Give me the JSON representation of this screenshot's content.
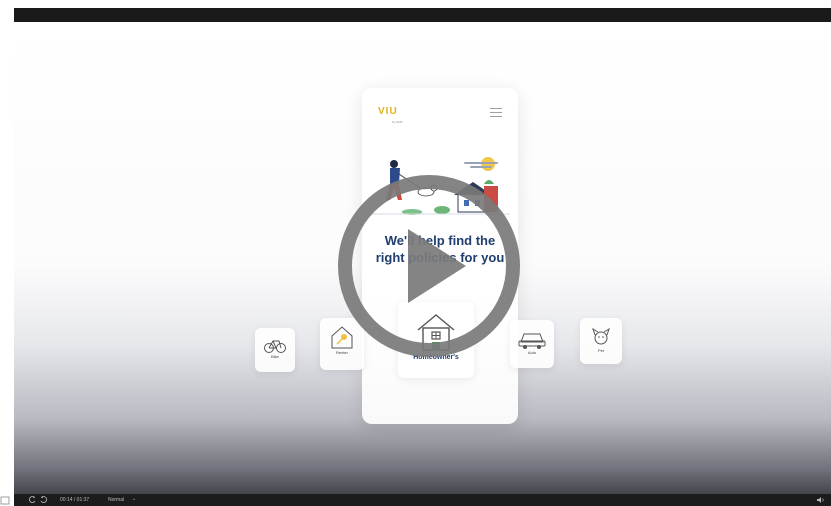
{
  "app": {
    "logo": "VIU",
    "logo_tagline": "by HUB",
    "headline_line1": "We'll help find the",
    "headline_line2": "right policies for you"
  },
  "categories": [
    {
      "label": "Bike",
      "icon": "bicycle-icon"
    },
    {
      "label": "Renter",
      "icon": "key-house-icon"
    },
    {
      "label": "Homeowner's",
      "icon": "house-icon"
    },
    {
      "label": "Auto",
      "icon": "car-icon"
    },
    {
      "label": "Pet",
      "icon": "dog-icon"
    }
  ],
  "player": {
    "time": "00:14 / 01:37",
    "speed": "Normal",
    "play_icon": "play-icon",
    "rewind_icon": "rewind-icon",
    "forward_icon": "forward-icon",
    "volume_icon": "volume-icon"
  },
  "colors": {
    "headline": "#1f3d6e",
    "logo": "#e0b21c",
    "play_overlay": "#7a7a7a",
    "player_bar": "#1c1c1c"
  }
}
